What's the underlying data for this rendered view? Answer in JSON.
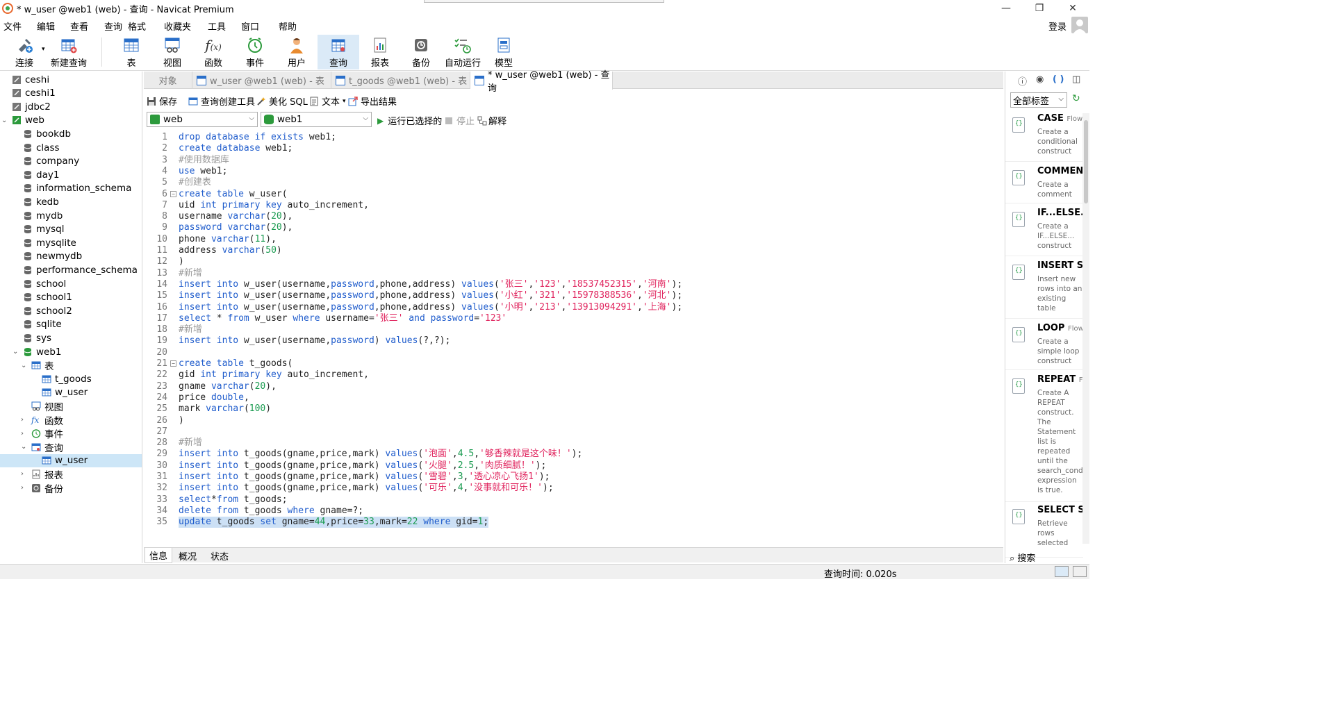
{
  "window": {
    "title": "* w_user @web1 (web) - 查询 - Navicat Premium",
    "controls": [
      "—",
      "❐",
      "✕"
    ]
  },
  "menu": {
    "items": [
      "文件",
      "编辑",
      "查看",
      "查询",
      "格式",
      "收藏夹",
      "工具",
      "窗口",
      "帮助"
    ],
    "login": "登录"
  },
  "toolbar": {
    "buttons": [
      "连接",
      "新建查询",
      "表",
      "视图",
      "函数",
      "事件",
      "用户",
      "查询",
      "报表",
      "备份",
      "自动运行",
      "模型"
    ],
    "active": "查询"
  },
  "tree": {
    "items": [
      {
        "label": "ceshi"
      },
      {
        "label": "ceshi1"
      },
      {
        "label": "jdbc2"
      },
      {
        "label": "web"
      },
      {
        "label": "bookdb"
      },
      {
        "label": "class"
      },
      {
        "label": "company"
      },
      {
        "label": "day1"
      },
      {
        "label": "information_schema"
      },
      {
        "label": "kedb"
      },
      {
        "label": "mydb"
      },
      {
        "label": "mysql"
      },
      {
        "label": "mysqlite"
      },
      {
        "label": "newmydb"
      },
      {
        "label": "performance_schema"
      },
      {
        "label": "school"
      },
      {
        "label": "school1"
      },
      {
        "label": "school2"
      },
      {
        "label": "sqlite"
      },
      {
        "label": "sys"
      },
      {
        "label": "web1"
      },
      {
        "label": "表"
      },
      {
        "label": "t_goods"
      },
      {
        "label": "w_user"
      },
      {
        "label": "视图"
      },
      {
        "label": "函数"
      },
      {
        "label": "事件"
      },
      {
        "label": "查询"
      },
      {
        "label": "w_user"
      },
      {
        "label": "报表"
      },
      {
        "label": "备份"
      }
    ],
    "selected": "w_user"
  },
  "tabs": [
    {
      "label": "对象"
    },
    {
      "label": "w_user @web1 (web) - 表"
    },
    {
      "label": "t_goods @web1 (web) - 表"
    },
    {
      "label": "* w_user @web1 (web) - 查询"
    }
  ],
  "query_toolbar": {
    "save": "保存",
    "builder": "查询创建工具",
    "beautify": "美化 SQL",
    "text": "文本",
    "export": "导出结果",
    "connection": "web",
    "database": "web1",
    "run_selected": "运行已选择的",
    "stop": "停止",
    "explain": "解释"
  },
  "editor": {
    "lines": [
      [
        [
          "kw",
          "drop database if exists"
        ],
        [
          "t",
          " web1;"
        ]
      ],
      [
        [
          "kw",
          "create database"
        ],
        [
          "t",
          " web1;"
        ]
      ],
      [
        [
          "cmt",
          "#使用数据库"
        ]
      ],
      [
        [
          "kw",
          "use"
        ],
        [
          "t",
          " web1;"
        ]
      ],
      [
        [
          "cmt",
          "#创建表"
        ]
      ],
      [
        [
          "kw",
          "create table"
        ],
        [
          "t",
          " w_user("
        ]
      ],
      [
        [
          "t",
          "uid "
        ],
        [
          "kw",
          "int primary key"
        ],
        [
          "t",
          " auto_increment,"
        ]
      ],
      [
        [
          "t",
          "username "
        ],
        [
          "kw",
          "varchar"
        ],
        [
          "t",
          "("
        ],
        [
          "num",
          "20"
        ],
        [
          "t",
          "),"
        ]
      ],
      [
        [
          "kw",
          "password varchar"
        ],
        [
          "t",
          "("
        ],
        [
          "num",
          "20"
        ],
        [
          "t",
          "),"
        ]
      ],
      [
        [
          "t",
          "phone "
        ],
        [
          "kw",
          "varchar"
        ],
        [
          "t",
          "("
        ],
        [
          "num",
          "11"
        ],
        [
          "t",
          "),"
        ]
      ],
      [
        [
          "t",
          "address "
        ],
        [
          "kw",
          "varchar"
        ],
        [
          "t",
          "("
        ],
        [
          "num",
          "50"
        ],
        [
          "t",
          ")"
        ]
      ],
      [
        [
          "t",
          ")"
        ]
      ],
      [
        [
          "cmt",
          "#新增"
        ]
      ],
      [
        [
          "kw",
          "insert into"
        ],
        [
          "t",
          " w_user(username,"
        ],
        [
          "kw",
          "password"
        ],
        [
          "t",
          ",phone,address) "
        ],
        [
          "kw",
          "values"
        ],
        [
          "t",
          "("
        ],
        [
          "str",
          "'张三'"
        ],
        [
          "t",
          ","
        ],
        [
          "str",
          "'123'"
        ],
        [
          "t",
          ","
        ],
        [
          "str",
          "'18537452315'"
        ],
        [
          "t",
          ","
        ],
        [
          "str",
          "'河南'"
        ],
        [
          "t",
          ");"
        ]
      ],
      [
        [
          "kw",
          "insert into"
        ],
        [
          "t",
          " w_user(username,"
        ],
        [
          "kw",
          "password"
        ],
        [
          "t",
          ",phone,address) "
        ],
        [
          "kw",
          "values"
        ],
        [
          "t",
          "("
        ],
        [
          "str",
          "'小红'"
        ],
        [
          "t",
          ","
        ],
        [
          "str",
          "'321'"
        ],
        [
          "t",
          ","
        ],
        [
          "str",
          "'15978388536'"
        ],
        [
          "t",
          ","
        ],
        [
          "str",
          "'河北'"
        ],
        [
          "t",
          ");"
        ]
      ],
      [
        [
          "kw",
          "insert into"
        ],
        [
          "t",
          " w_user(username,"
        ],
        [
          "kw",
          "password"
        ],
        [
          "t",
          ",phone,address) "
        ],
        [
          "kw",
          "values"
        ],
        [
          "t",
          "("
        ],
        [
          "str",
          "'小明'"
        ],
        [
          "t",
          ","
        ],
        [
          "str",
          "'213'"
        ],
        [
          "t",
          ","
        ],
        [
          "str",
          "'13913094291'"
        ],
        [
          "t",
          ","
        ],
        [
          "str",
          "'上海'"
        ],
        [
          "t",
          ");"
        ]
      ],
      [
        [
          "kw",
          "select"
        ],
        [
          "t",
          " * "
        ],
        [
          "kw",
          "from"
        ],
        [
          "t",
          " w_user "
        ],
        [
          "kw",
          "where"
        ],
        [
          "t",
          " username="
        ],
        [
          "str",
          "'张三'"
        ],
        [
          "t",
          " "
        ],
        [
          "kw",
          "and password"
        ],
        [
          "t",
          "="
        ],
        [
          "str",
          "'123'"
        ]
      ],
      [
        [
          "cmt",
          "#新增"
        ]
      ],
      [
        [
          "kw",
          "insert into"
        ],
        [
          "t",
          " w_user(username,"
        ],
        [
          "kw",
          "password"
        ],
        [
          "t",
          ") "
        ],
        [
          "kw",
          "values"
        ],
        [
          "t",
          "(?,?);"
        ]
      ],
      [],
      [
        [
          "kw",
          "create table"
        ],
        [
          "t",
          " t_goods("
        ]
      ],
      [
        [
          "t",
          "gid "
        ],
        [
          "kw",
          "int primary key"
        ],
        [
          "t",
          " auto_increment,"
        ]
      ],
      [
        [
          "t",
          "gname "
        ],
        [
          "kw",
          "varchar"
        ],
        [
          "t",
          "("
        ],
        [
          "num",
          "20"
        ],
        [
          "t",
          "),"
        ]
      ],
      [
        [
          "t",
          "price "
        ],
        [
          "kw",
          "double"
        ],
        [
          "t",
          ","
        ]
      ],
      [
        [
          "t",
          "mark "
        ],
        [
          "kw",
          "varchar"
        ],
        [
          "t",
          "("
        ],
        [
          "num",
          "100"
        ],
        [
          "t",
          ")"
        ]
      ],
      [
        [
          "t",
          ")"
        ]
      ],
      [],
      [
        [
          "cmt",
          "#新增"
        ]
      ],
      [
        [
          "kw",
          "insert into"
        ],
        [
          "t",
          " t_goods(gname,price,mark) "
        ],
        [
          "kw",
          "values"
        ],
        [
          "t",
          "("
        ],
        [
          "str",
          "'泡面'"
        ],
        [
          "t",
          ","
        ],
        [
          "num",
          "4.5"
        ],
        [
          "t",
          ","
        ],
        [
          "str",
          "'够香辣就是这个味！'"
        ],
        [
          "t",
          ");"
        ]
      ],
      [
        [
          "kw",
          "insert into"
        ],
        [
          "t",
          " t_goods(gname,price,mark) "
        ],
        [
          "kw",
          "values"
        ],
        [
          "t",
          "("
        ],
        [
          "str",
          "'火腿'"
        ],
        [
          "t",
          ","
        ],
        [
          "num",
          "2.5"
        ],
        [
          "t",
          ","
        ],
        [
          "str",
          "'肉质细腻！'"
        ],
        [
          "t",
          ");"
        ]
      ],
      [
        [
          "kw",
          "insert into"
        ],
        [
          "t",
          " t_goods(gname,price,mark) "
        ],
        [
          "kw",
          "values"
        ],
        [
          "t",
          "("
        ],
        [
          "str",
          "'雪碧'"
        ],
        [
          "t",
          ","
        ],
        [
          "num",
          "3"
        ],
        [
          "t",
          ","
        ],
        [
          "str",
          "'透心凉心飞扬1'"
        ],
        [
          "t",
          ");"
        ]
      ],
      [
        [
          "kw",
          "insert into"
        ],
        [
          "t",
          " t_goods(gname,price,mark) "
        ],
        [
          "kw",
          "values"
        ],
        [
          "t",
          "("
        ],
        [
          "str",
          "'可乐'"
        ],
        [
          "t",
          ","
        ],
        [
          "num",
          "4"
        ],
        [
          "t",
          ","
        ],
        [
          "str",
          "'没事就和可乐！'"
        ],
        [
          "t",
          ");"
        ]
      ],
      [
        [
          "kw",
          "select"
        ],
        [
          "t",
          "*"
        ],
        [
          "kw",
          "from"
        ],
        [
          "t",
          " t_goods;"
        ]
      ],
      [
        [
          "kw",
          "delete from"
        ],
        [
          "t",
          " t_goods "
        ],
        [
          "kw",
          "where"
        ],
        [
          "t",
          " gname=?;"
        ]
      ],
      [
        [
          "kw",
          "update"
        ],
        [
          "t",
          " t_goods "
        ],
        [
          "kw",
          "set"
        ],
        [
          "t",
          " gname="
        ],
        [
          "num",
          "44"
        ],
        [
          "t",
          ",price="
        ],
        [
          "num",
          "33"
        ],
        [
          "t",
          ",mark="
        ],
        [
          "num",
          "22"
        ],
        [
          "t",
          " "
        ],
        [
          "kw",
          "where"
        ],
        [
          "t",
          " gid="
        ],
        [
          "num",
          "1"
        ],
        [
          "t",
          ";"
        ]
      ]
    ],
    "highlighted_line": 35,
    "fold_lines": [
      6,
      21
    ]
  },
  "bottom_tabs": [
    "信息",
    "概况",
    "状态"
  ],
  "status": {
    "query_time": "查询时间: 0.020s"
  },
  "right_panel": {
    "filter": "全部标签",
    "search": "搜索",
    "snippets": [
      {
        "title": "CASE",
        "tag": "Flow",
        "desc": "Create a conditional construct"
      },
      {
        "title": "COMMENT",
        "tag": "",
        "desc": "Create a comment"
      },
      {
        "title": "IF...ELSE...",
        "tag": "",
        "desc": "Create a IF...ELSE... construct"
      },
      {
        "title": "INSERT Syntax",
        "tag": "",
        "desc": "Insert new rows into an existing table"
      },
      {
        "title": "LOOP",
        "tag": "Flow",
        "desc": "Create a simple loop construct"
      },
      {
        "title": "REPEAT",
        "tag": "Flow",
        "desc": "Create A REPEAT construct. The Statement list is repeated until the search_condition expression is true."
      },
      {
        "title": "SELECT Syntax",
        "tag": "",
        "desc": "Retrieve rows selected"
      }
    ]
  },
  "colors": {
    "keyword": "#1f5ccc",
    "string": "#e0245e",
    "number": "#1a9b50",
    "comment": "#9a9a9a",
    "selection": "#cde6f7"
  }
}
